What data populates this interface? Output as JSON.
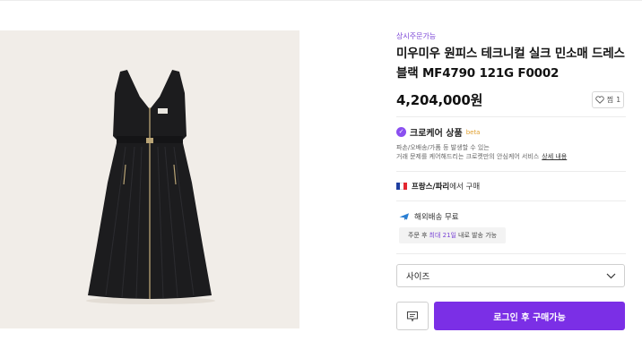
{
  "product": {
    "badge": "상시주문가능",
    "title": "미우미우 원피스 테크니컬 실크 민소매 드레스 블랙 MF4790 121G F0002",
    "price": "4,204,000원",
    "like_label": "찜",
    "like_count": "1"
  },
  "care": {
    "title": "크로케어 상품",
    "beta": "beta",
    "desc_line1": "파손/오배송/가품 등 발생할 수 있는",
    "desc_line2": "거래 문제를 케어해드리는 크로켓만의 안심케어 서비스",
    "link": "상세 내용"
  },
  "origin": {
    "country": "프랑스/파리",
    "suffix": "에서 구매",
    "flag_colors": [
      "#1f3fa0",
      "#ffffff",
      "#e3262f"
    ]
  },
  "shipping": {
    "label": "해외배송 무료",
    "info_prefix": "주문 후",
    "info_highlight": "최대 21일",
    "info_suffix": "내로 발송 가능"
  },
  "size_select": {
    "label": "사이즈"
  },
  "buttons": {
    "login_buy": "로그인 후 구매가능"
  },
  "colors": {
    "accent": "#7b2fe6",
    "badge": "#7a43d6",
    "image_bg": "#f1ede8",
    "dress": "#1c1c1e"
  },
  "icons": {
    "like": "heart-outline-icon",
    "care": "shield-check-icon",
    "shipping": "plane-icon",
    "select": "chevron-down-icon",
    "message": "message-icon"
  }
}
